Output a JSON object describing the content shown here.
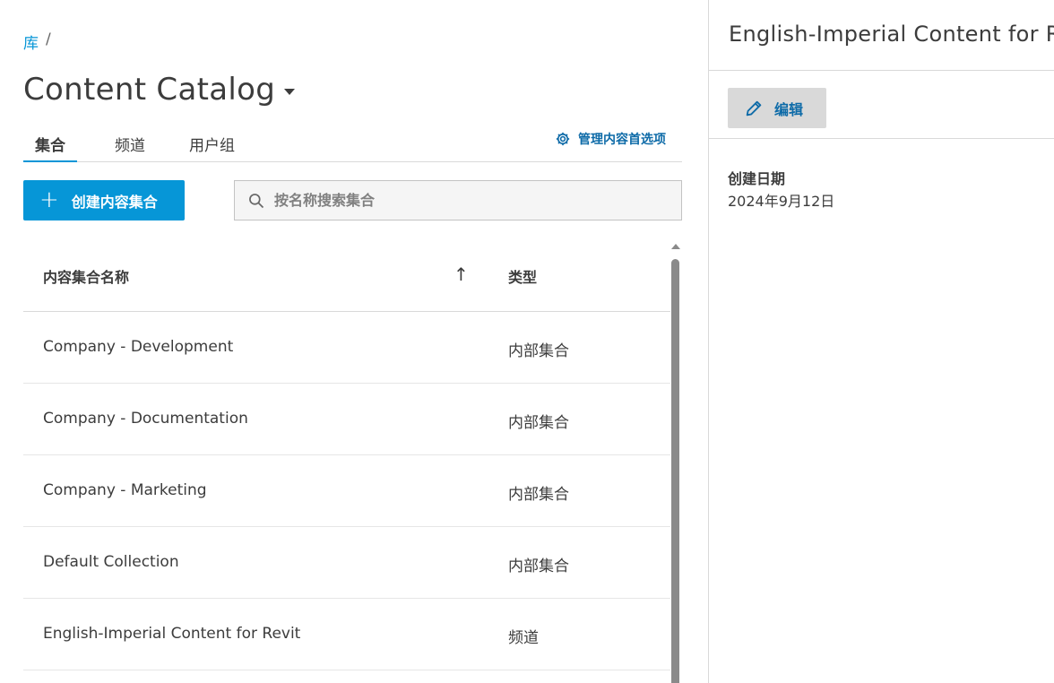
{
  "breadcrumb": {
    "root": "库",
    "separator": "/"
  },
  "page": {
    "title": "Content Catalog"
  },
  "tabs": [
    {
      "label": "集合",
      "active": true
    },
    {
      "label": "频道",
      "active": false
    },
    {
      "label": "用户组",
      "active": false
    }
  ],
  "manage": {
    "label": "管理内容首选项",
    "icon": "gear-icon"
  },
  "create_button": {
    "label": "创建内容集合",
    "icon": "plus-icon"
  },
  "search": {
    "placeholder": "按名称搜索集合",
    "value": ""
  },
  "table": {
    "columns": {
      "name": "内容集合名称",
      "type": "类型"
    },
    "sort": {
      "column": "name",
      "direction": "ascending"
    },
    "rows": [
      {
        "name": "Company - Development",
        "type": "内部集合"
      },
      {
        "name": "Company - Documentation",
        "type": "内部集合"
      },
      {
        "name": "Company - Marketing",
        "type": "内部集合"
      },
      {
        "name": "Default Collection",
        "type": "内部集合"
      },
      {
        "name": "English-Imperial Content for Revit",
        "type": "频道"
      }
    ]
  },
  "detail": {
    "title": "English-Imperial Content for Revit",
    "edit_label": "编辑",
    "created_label": "创建日期",
    "created_value": "2024年9月12日"
  },
  "colors": {
    "accent": "#0696d7",
    "link": "#0e6ba8",
    "text": "#3c3c3c",
    "border": "#d9d9d9"
  }
}
